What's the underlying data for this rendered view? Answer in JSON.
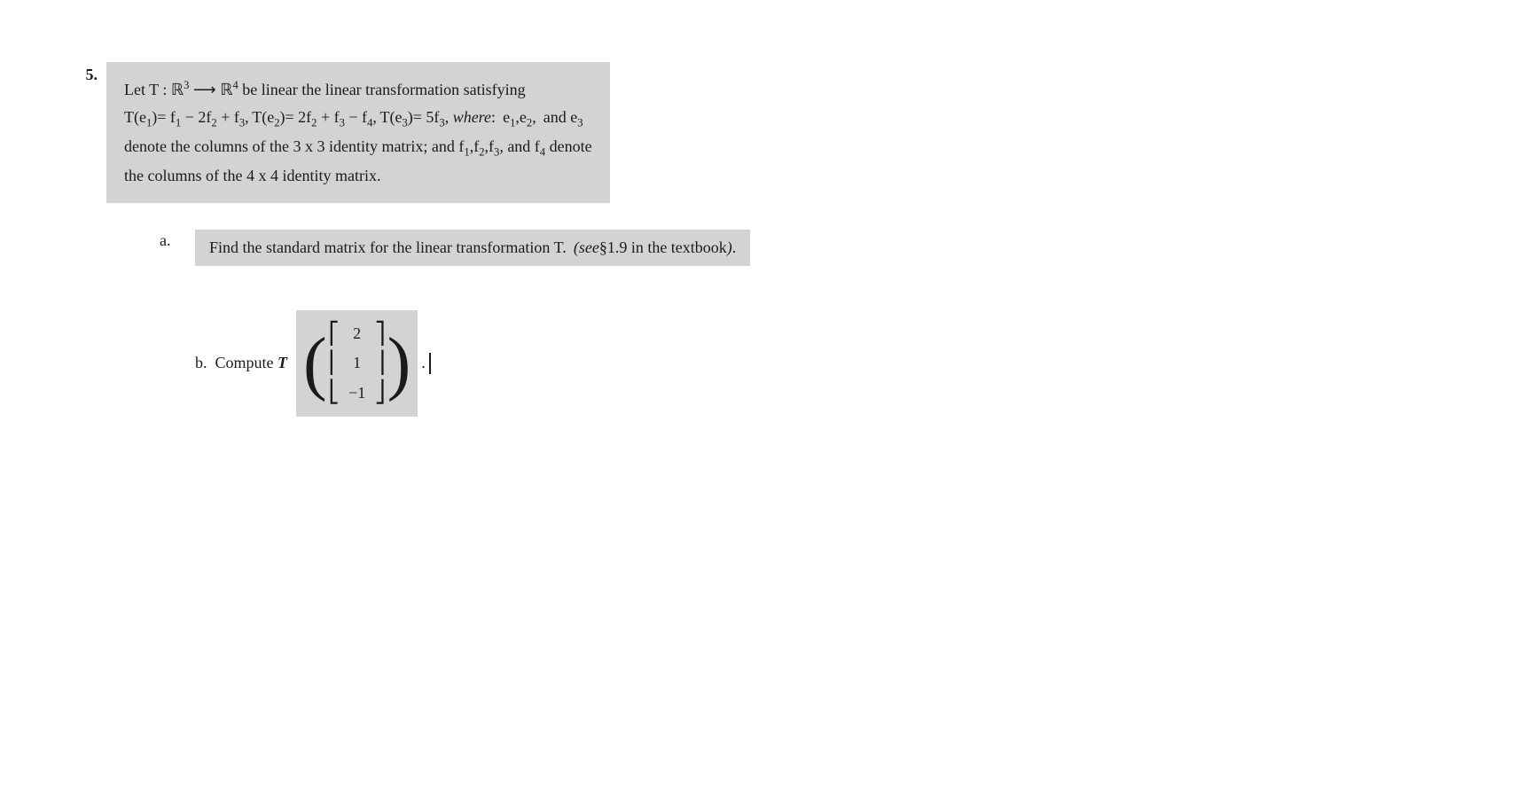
{
  "problem": {
    "number": "5.",
    "statement_line1": "Let T : ℝ³ ⟶ ℝ⁴ be linear the linear transformation satisfying",
    "statement_line2": "T(e₁)= f₁ − 2f₂ + f₃, T(e₂)= 2f₂ + f₃ − f₄, T(e₃)= 5f₃,  where:  e₁,e₂,  and e₃",
    "statement_line3": "denote the columns of the 3 x 3 identity matrix; and f₁,f₂,f₃, and f₄ denote",
    "statement_line4": "the columns of the 4 x 4 identity matrix.",
    "sub_a": {
      "label": "a.",
      "text": "Find the standard matrix for the linear transformation T. (see§1.9 in the textbook)."
    },
    "sub_b": {
      "label": "b.",
      "text": "Compute T",
      "matrix_values": [
        "2",
        "1",
        "−1"
      ]
    }
  }
}
